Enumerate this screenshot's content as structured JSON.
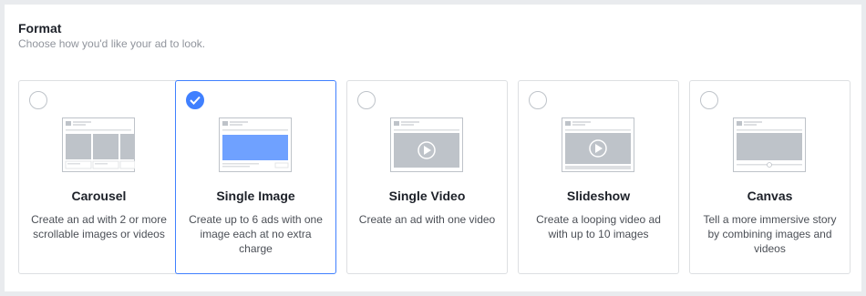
{
  "header": {
    "title": "Format",
    "subtitle": "Choose how you'd like your ad to look."
  },
  "formats": [
    {
      "title": "Carousel",
      "description": "Create an ad with 2 or more scrollable images or videos",
      "selected": false,
      "preview_icon": "carousel-preview-icon"
    },
    {
      "title": "Single Image",
      "description": "Create up to 6 ads with one image each at no extra charge",
      "selected": true,
      "preview_icon": "single-image-preview-icon"
    },
    {
      "title": "Single Video",
      "description": "Create an ad with one video",
      "selected": false,
      "preview_icon": "single-video-preview-icon"
    },
    {
      "title": "Slideshow",
      "description": "Create a looping video ad with up to 10 images",
      "selected": false,
      "preview_icon": "slideshow-preview-icon"
    },
    {
      "title": "Canvas",
      "description": "Tell a more immersive story by combining images and videos",
      "selected": false,
      "preview_icon": "canvas-preview-icon"
    }
  ],
  "colors": {
    "accent": "#4080ff",
    "card_border": "#dddfe2",
    "placeholder_gray": "#bec3c9",
    "selected_image_fill": "#6fa1ff"
  }
}
